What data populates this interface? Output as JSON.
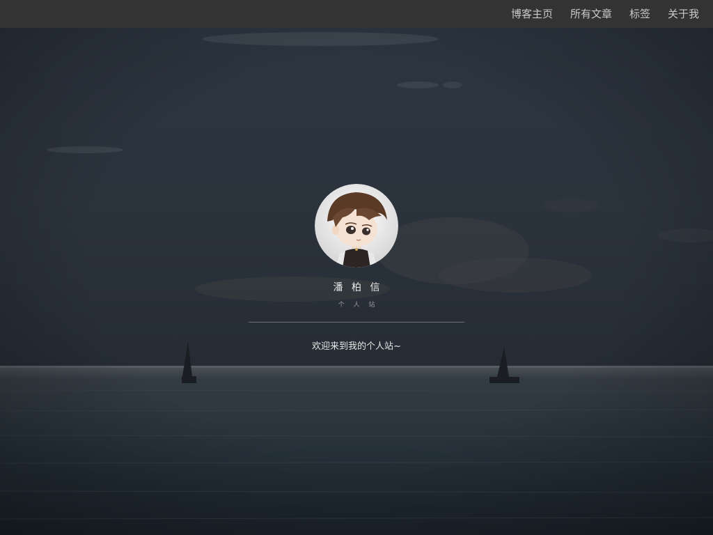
{
  "nav": {
    "items": [
      {
        "label": "博客主页"
      },
      {
        "label": "所有文章"
      },
      {
        "label": "标签"
      },
      {
        "label": "关于我"
      }
    ]
  },
  "profile": {
    "name": "潘 柏 信",
    "subtitle": "个 人 站",
    "welcome": "欢迎来到我的个人站~"
  },
  "colors": {
    "topbar": "#333333",
    "sky": "#2b3440",
    "sea": "#27323b",
    "nav_text": "#c9c9c9"
  }
}
